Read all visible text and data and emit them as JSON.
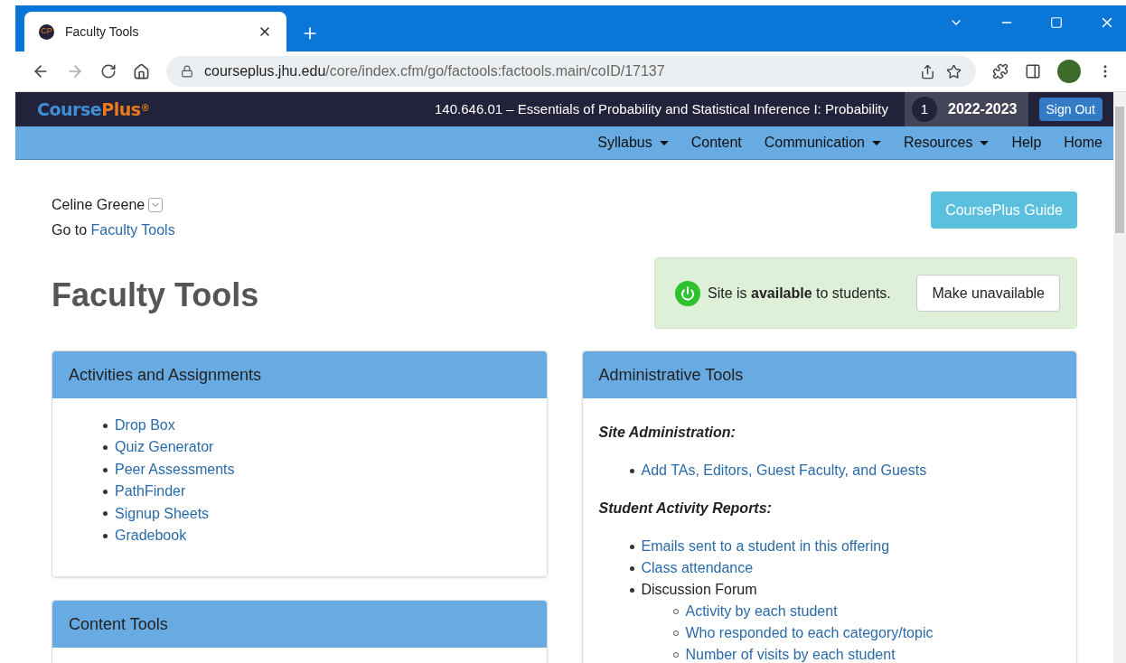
{
  "browser": {
    "tab": {
      "title": "Faculty Tools",
      "favicon": "CP"
    },
    "url": {
      "host": "courseplus.jhu.edu",
      "path": "/core/index.cfm/go/factools:factools.main/coID/17137"
    }
  },
  "site_header": {
    "logo": {
      "first": "Course",
      "second": "Plus",
      "mark": "®"
    },
    "course_title": "140.646.01 – Essentials of Probability and Statistical Inference I: Probability",
    "term": "1",
    "year": "2022-2023",
    "sign_out": "Sign Out"
  },
  "nav": [
    {
      "label": "Syllabus",
      "dropdown": true
    },
    {
      "label": "Content",
      "dropdown": false
    },
    {
      "label": "Communication",
      "dropdown": true
    },
    {
      "label": "Resources",
      "dropdown": true
    },
    {
      "label": "Help",
      "dropdown": false
    },
    {
      "label": "Home",
      "dropdown": false
    }
  ],
  "user": {
    "name": "Celine Greene",
    "goto_prefix": "Go to",
    "goto_link": "Faculty Tools"
  },
  "guide_button": "CoursePlus Guide",
  "availability": {
    "available": true,
    "message": "Site is **available** to students.",
    "button": "Make unavailable"
  },
  "page_title": "Faculty Tools",
  "left_panels": [
    {
      "title": "Activities and Assignments",
      "items": [
        "Drop Box",
        "Quiz Generator",
        "Peer Assessments",
        "PathFinder",
        "Signup Sheets",
        "Gradebook"
      ]
    },
    {
      "title": "Content Tools"
    }
  ],
  "admin_panel": {
    "title": "Administrative Tools",
    "sections": [
      {
        "heading": "Site Administration:",
        "items": [
          {
            "label": "Add TAs, Editors, Guest Faculty, and Guests",
            "kind": "link"
          }
        ]
      },
      {
        "heading": "Student Activity Reports:",
        "items": [
          {
            "label": "Emails sent to a student in this offering",
            "kind": "link"
          },
          {
            "label": "Class attendance",
            "kind": "link"
          },
          {
            "label": "Discussion Forum",
            "kind": "text",
            "children": [
              {
                "label": "Activity by each student",
                "kind": "link"
              },
              {
                "label": "Who responded to each category/topic",
                "kind": "link"
              },
              {
                "label": "Number of visits by each student",
                "kind": "link"
              }
            ]
          }
        ]
      }
    ]
  }
}
